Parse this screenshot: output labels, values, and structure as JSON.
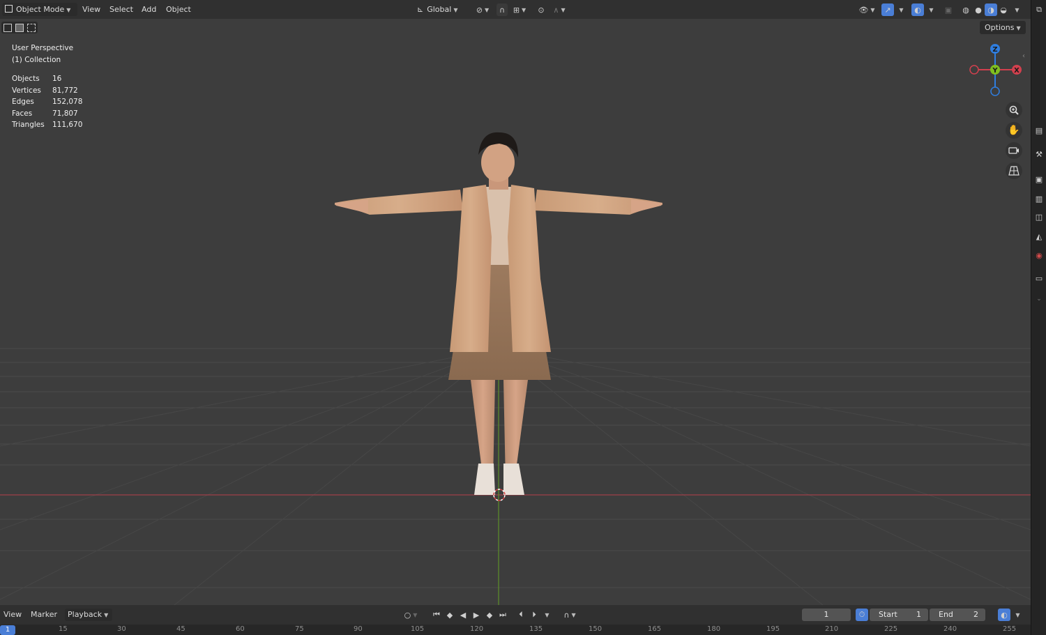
{
  "header": {
    "mode": "Object Mode",
    "menus": [
      "View",
      "Select",
      "Add",
      "Object"
    ],
    "orientation": "Global",
    "options_label": "Options"
  },
  "viewport": {
    "view_name": "User Perspective",
    "collection": "(1) Collection",
    "stats": [
      {
        "label": "Objects",
        "value": "16"
      },
      {
        "label": "Vertices",
        "value": "81,772"
      },
      {
        "label": "Edges",
        "value": "152,078"
      },
      {
        "label": "Faces",
        "value": "71,807"
      },
      {
        "label": "Triangles",
        "value": "111,670"
      }
    ],
    "gizmo": {
      "z": "Z",
      "y": "Y",
      "x": "X"
    }
  },
  "timeline": {
    "menus": [
      "View",
      "Marker",
      "Playback"
    ],
    "current_frame": "1",
    "start_label": "Start",
    "start_value": "1",
    "end_label": "End",
    "end_value": "2",
    "ruler_current": "1",
    "ruler_ticks": [
      "15",
      "30",
      "45",
      "60",
      "75",
      "90",
      "105",
      "120",
      "135",
      "150",
      "165",
      "180",
      "195",
      "210",
      "225",
      "240",
      "255"
    ]
  },
  "colors": {
    "x_axis": "#d2404e",
    "y_axis": "#7fbf1f",
    "z_axis": "#2f7ee0",
    "accent": "#4a7ed6"
  }
}
